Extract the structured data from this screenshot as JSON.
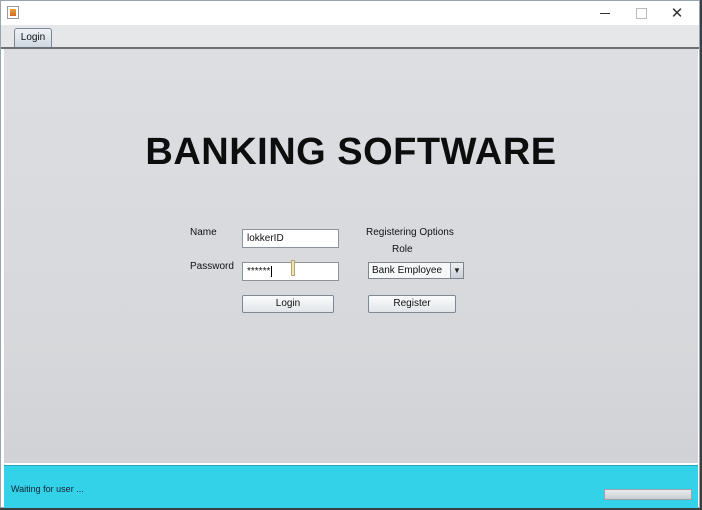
{
  "window": {
    "close_glyph": "✕"
  },
  "tabs": [
    {
      "label": "Login",
      "active": true
    }
  ],
  "main": {
    "title": "BANKING SOFTWARE",
    "name_label": "Name",
    "name_value": "lokkerID",
    "password_label": "Password",
    "password_value": "******",
    "registering_options_label": "Registering Options",
    "role_label": "Role",
    "role_selected": "Bank Employee",
    "login_button": "Login",
    "register_button": "Register"
  },
  "status": {
    "text": "Waiting for user ...",
    "progress": 0
  },
  "colors": {
    "status_bar": "#33d2e8",
    "content_bg": "#d8dadd"
  }
}
